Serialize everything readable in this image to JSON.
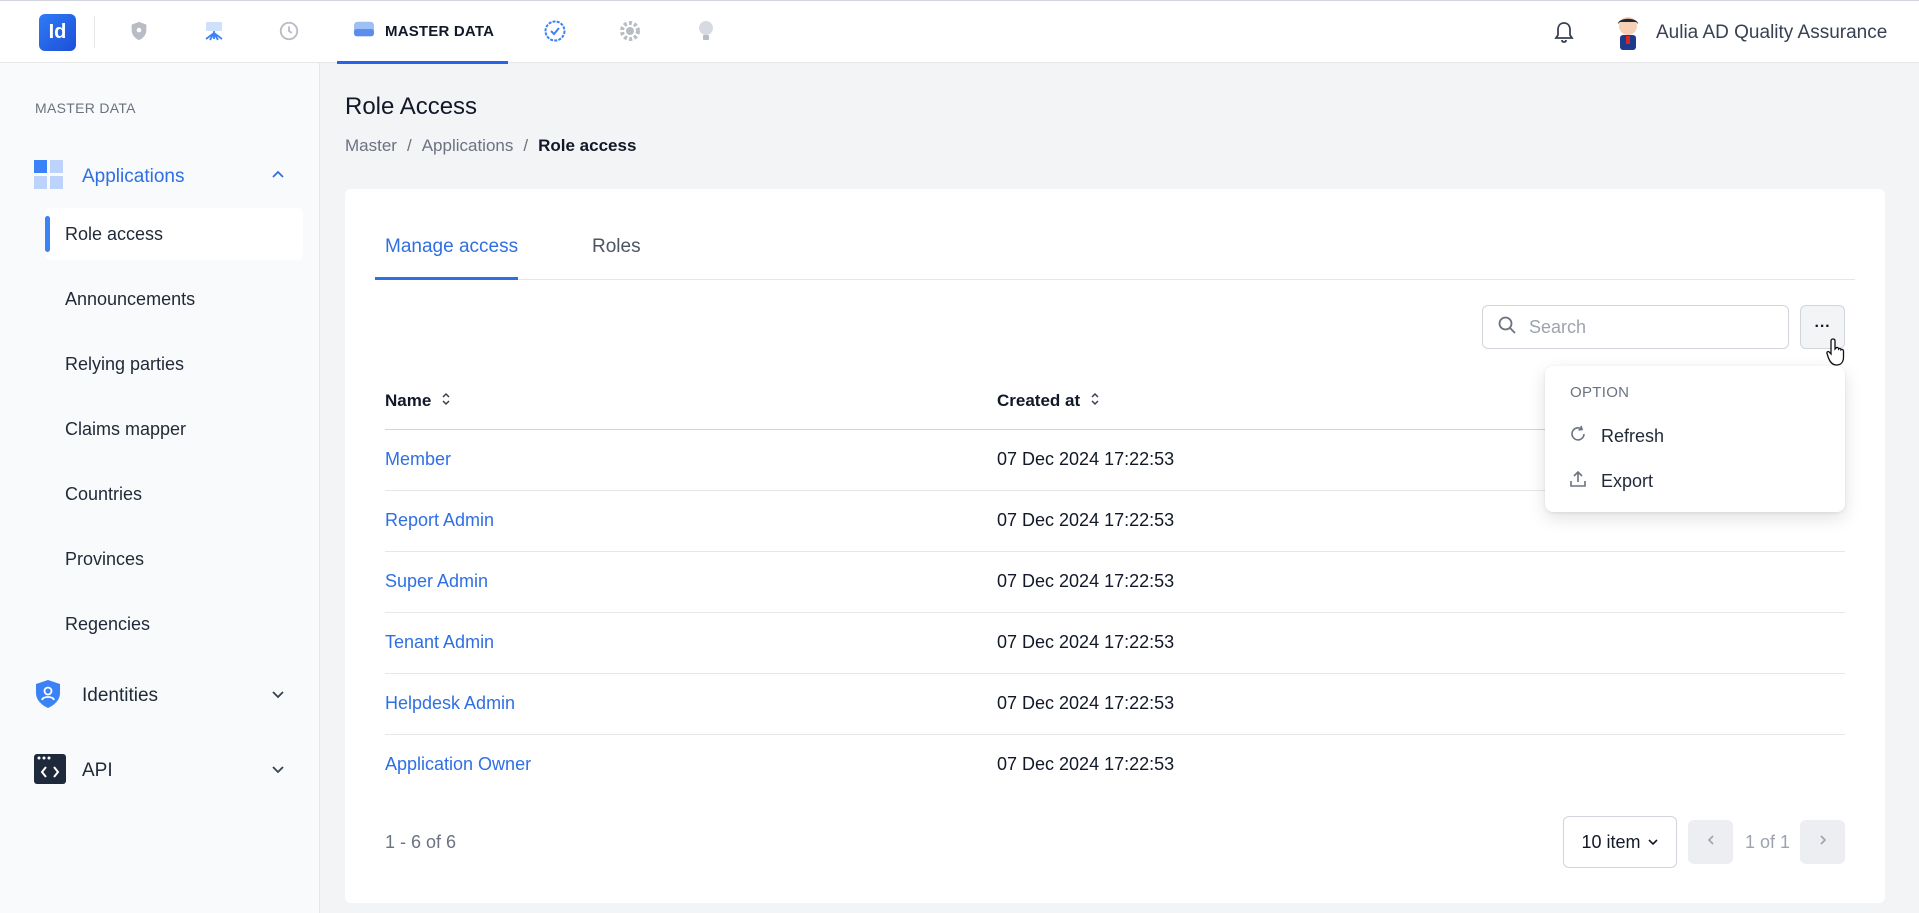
{
  "topbar": {
    "logo_text": "Id",
    "active_nav_label": "MASTER DATA",
    "user_name": "Aulia AD Quality Assurance",
    "nav_icons": [
      "shield-icon",
      "network-icon",
      "history-icon",
      "database-icon",
      "badge-check-icon",
      "gear-icon",
      "lightbulb-icon"
    ]
  },
  "sidebar": {
    "section_label": "MASTER DATA",
    "applications_label": "Applications",
    "items": [
      {
        "label": "Role access"
      },
      {
        "label": "Announcements"
      },
      {
        "label": "Relying parties"
      },
      {
        "label": "Claims mapper"
      },
      {
        "label": "Countries"
      },
      {
        "label": "Provinces"
      },
      {
        "label": "Regencies"
      }
    ],
    "identities_label": "Identities",
    "api_label": "API"
  },
  "main": {
    "title": "Role Access",
    "breadcrumb": [
      "Master",
      "Applications",
      "Role access"
    ],
    "tabs": [
      {
        "label": "Manage access"
      },
      {
        "label": "Roles"
      }
    ],
    "search_placeholder": "Search",
    "more_label": "···",
    "columns": {
      "name": "Name",
      "created_at": "Created at"
    },
    "rows": [
      {
        "name": "Member",
        "created_at": "07 Dec 2024 17:22:53"
      },
      {
        "name": "Report Admin",
        "created_at": "07 Dec 2024 17:22:53"
      },
      {
        "name": "Super Admin",
        "created_at": "07 Dec 2024 17:22:53"
      },
      {
        "name": "Tenant Admin",
        "created_at": "07 Dec 2024 17:22:53"
      },
      {
        "name": "Helpdesk Admin",
        "created_at": "07 Dec 2024 17:22:53"
      },
      {
        "name": "Application Owner",
        "created_at": "07 Dec 2024 17:22:53"
      }
    ],
    "count_text": "1 - 6 of 6",
    "per_page": "10 item",
    "page_text": "1 of 1"
  },
  "dropdown": {
    "header": "OPTION",
    "items": [
      {
        "label": "Refresh"
      },
      {
        "label": "Export"
      }
    ]
  },
  "colors": {
    "accent": "#2f6fe4",
    "brand": "#2563eb"
  }
}
